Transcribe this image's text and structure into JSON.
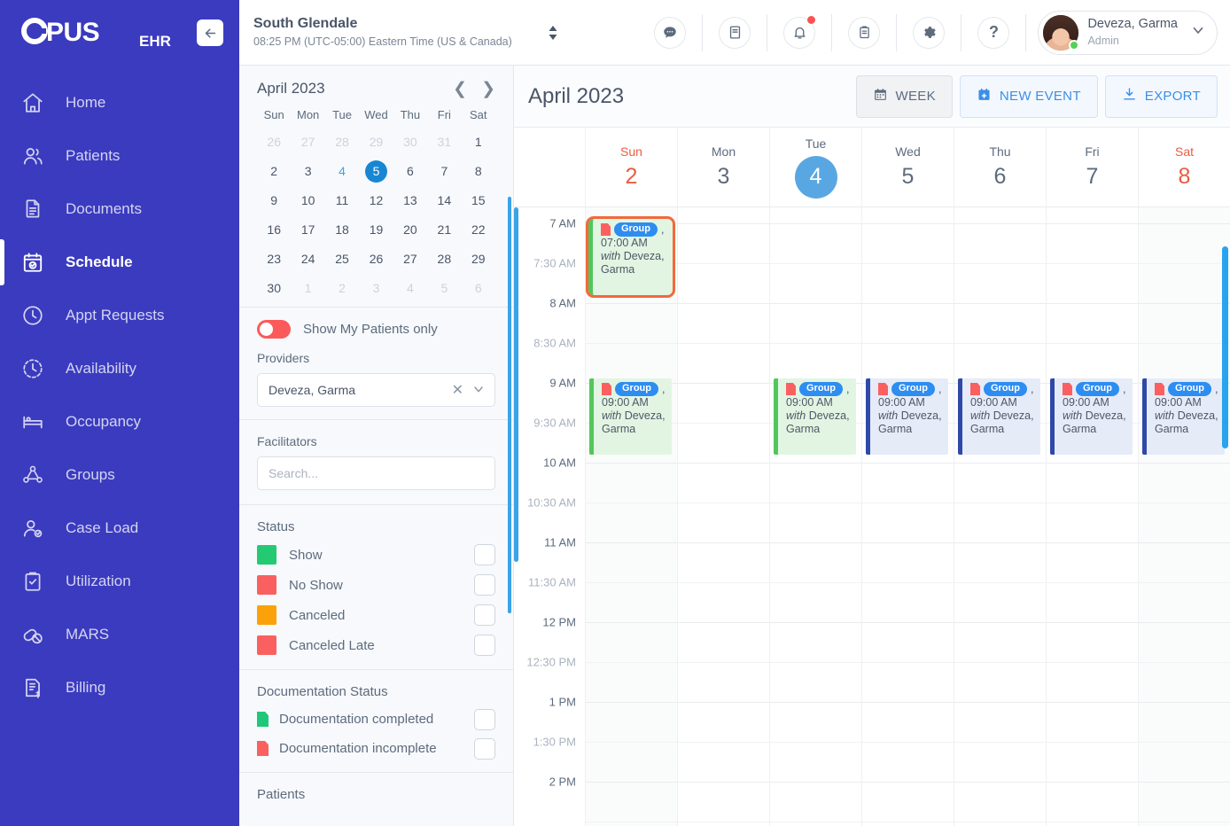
{
  "brand": {
    "logo": "OPUS",
    "suffix": "EHR",
    "collapse_icon": "arrow-left-icon"
  },
  "sidebar": {
    "items": [
      {
        "label": "Home",
        "icon": "home-icon",
        "active": false
      },
      {
        "label": "Patients",
        "icon": "users-icon",
        "active": false
      },
      {
        "label": "Documents",
        "icon": "documents-icon",
        "active": false
      },
      {
        "label": "Schedule",
        "icon": "calendar-check-icon",
        "active": true
      },
      {
        "label": "Appt Requests",
        "icon": "clock-icon",
        "active": false
      },
      {
        "label": "Availability",
        "icon": "clock-dashed-icon",
        "active": false
      },
      {
        "label": "Occupancy",
        "icon": "bed-icon",
        "active": false
      },
      {
        "label": "Groups",
        "icon": "group-network-icon",
        "active": false
      },
      {
        "label": "Case Load",
        "icon": "user-check-icon",
        "active": false
      },
      {
        "label": "Utilization",
        "icon": "clipboard-check-icon",
        "active": false
      },
      {
        "label": "MARS",
        "icon": "pills-icon",
        "active": false
      },
      {
        "label": "Billing",
        "icon": "invoice-dollar-icon",
        "active": false
      }
    ]
  },
  "topbar": {
    "location_name": "South Glendale",
    "location_time": "08:25 PM (UTC-05:00) Eastern Time (US & Canada)",
    "location_switch_icon": "sort-updown-icon",
    "icons": [
      {
        "name": "chat-icon",
        "glyph": "●●●",
        "badge": false
      },
      {
        "name": "book-icon",
        "glyph": "book",
        "badge": false
      },
      {
        "name": "bell-icon",
        "glyph": "bell",
        "badge": true
      },
      {
        "name": "clipboard-icon",
        "glyph": "clipboard",
        "badge": false
      },
      {
        "name": "gear-icon",
        "glyph": "gear",
        "badge": false
      },
      {
        "name": "help-icon",
        "glyph": "?",
        "badge": false
      }
    ],
    "user": {
      "name": "Deveza, Garma",
      "role": "Admin",
      "status": "online",
      "chevron": "chevron-down-icon"
    }
  },
  "filters": {
    "minicalendar": {
      "title": "April 2023",
      "prev_icon": "chevron-left-icon",
      "next_icon": "chevron-right-icon",
      "dow": [
        "Sun",
        "Mon",
        "Tue",
        "Wed",
        "Thu",
        "Fri",
        "Sat"
      ],
      "weeks": [
        [
          {
            "d": "26",
            "s": "muted"
          },
          {
            "d": "27",
            "s": "muted"
          },
          {
            "d": "28",
            "s": "muted"
          },
          {
            "d": "29",
            "s": "muted"
          },
          {
            "d": "30",
            "s": "muted"
          },
          {
            "d": "31",
            "s": "muted"
          },
          {
            "d": "1",
            "s": ""
          }
        ],
        [
          {
            "d": "2",
            "s": ""
          },
          {
            "d": "3",
            "s": ""
          },
          {
            "d": "4",
            "s": "accent"
          },
          {
            "d": "5",
            "s": "sel"
          },
          {
            "d": "6",
            "s": ""
          },
          {
            "d": "7",
            "s": ""
          },
          {
            "d": "8",
            "s": ""
          }
        ],
        [
          {
            "d": "9",
            "s": ""
          },
          {
            "d": "10",
            "s": ""
          },
          {
            "d": "11",
            "s": ""
          },
          {
            "d": "12",
            "s": ""
          },
          {
            "d": "13",
            "s": ""
          },
          {
            "d": "14",
            "s": ""
          },
          {
            "d": "15",
            "s": ""
          }
        ],
        [
          {
            "d": "16",
            "s": ""
          },
          {
            "d": "17",
            "s": ""
          },
          {
            "d": "18",
            "s": ""
          },
          {
            "d": "19",
            "s": ""
          },
          {
            "d": "20",
            "s": ""
          },
          {
            "d": "21",
            "s": ""
          },
          {
            "d": "22",
            "s": ""
          }
        ],
        [
          {
            "d": "23",
            "s": ""
          },
          {
            "d": "24",
            "s": ""
          },
          {
            "d": "25",
            "s": ""
          },
          {
            "d": "26",
            "s": ""
          },
          {
            "d": "27",
            "s": ""
          },
          {
            "d": "28",
            "s": ""
          },
          {
            "d": "29",
            "s": ""
          }
        ],
        [
          {
            "d": "30",
            "s": ""
          },
          {
            "d": "1",
            "s": "muted"
          },
          {
            "d": "2",
            "s": "muted"
          },
          {
            "d": "3",
            "s": "muted"
          },
          {
            "d": "4",
            "s": "muted"
          },
          {
            "d": "5",
            "s": "muted"
          },
          {
            "d": "6",
            "s": "muted"
          }
        ]
      ]
    },
    "my_patients_toggle": {
      "label": "Show My Patients only",
      "on": true
    },
    "providers": {
      "label": "Providers",
      "value": "Deveza, Garma",
      "clear_icon": "clear-x-icon",
      "chevron": "chevron-down-icon"
    },
    "facilitators": {
      "label": "Facilitators",
      "placeholder": "Search...",
      "value": ""
    },
    "status": {
      "label": "Status",
      "items": [
        {
          "label": "Show",
          "color": "#23ca72",
          "checked": false
        },
        {
          "label": "No Show",
          "color": "#fb6060",
          "checked": false
        },
        {
          "label": "Canceled",
          "color": "#fba20a",
          "checked": false
        },
        {
          "label": "Canceled Late",
          "color": "#fb6060",
          "checked": false
        }
      ]
    },
    "documentation_status": {
      "label": "Documentation Status",
      "items": [
        {
          "label": "Documentation completed",
          "color": "#1fc878",
          "checked": false
        },
        {
          "label": "Documentation incomplete",
          "color": "#fb6060",
          "checked": false
        }
      ]
    },
    "patients_section_label": "Patients"
  },
  "calendar": {
    "title": "April 2023",
    "buttons": [
      {
        "label": "WEEK",
        "icon": "calendar-icon",
        "style": "week"
      },
      {
        "label": "NEW EVENT",
        "icon": "calendar-plus-icon",
        "style": "blue"
      },
      {
        "label": "EXPORT",
        "icon": "download-icon",
        "style": "blue"
      }
    ],
    "days": [
      {
        "dow": "Sun",
        "num": "2",
        "weekend": true,
        "today": false
      },
      {
        "dow": "Mon",
        "num": "3",
        "weekend": false,
        "today": false
      },
      {
        "dow": "Tue",
        "num": "4",
        "weekend": false,
        "today": true
      },
      {
        "dow": "Wed",
        "num": "5",
        "weekend": false,
        "today": false
      },
      {
        "dow": "Thu",
        "num": "6",
        "weekend": false,
        "today": false
      },
      {
        "dow": "Fri",
        "num": "7",
        "weekend": false,
        "today": false
      },
      {
        "dow": "Sat",
        "num": "8",
        "weekend": true,
        "today": false
      }
    ],
    "time_labels": [
      {
        "t": "7 AM",
        "half": false
      },
      {
        "t": "7:30 AM",
        "half": true
      },
      {
        "t": "8 AM",
        "half": false
      },
      {
        "t": "8:30 AM",
        "half": true
      },
      {
        "t": "9 AM",
        "half": false
      },
      {
        "t": "9:30 AM",
        "half": true
      },
      {
        "t": "10 AM",
        "half": false
      },
      {
        "t": "10:30 AM",
        "half": true
      },
      {
        "t": "11 AM",
        "half": false
      },
      {
        "t": "11:30 AM",
        "half": true
      },
      {
        "t": "12 PM",
        "half": false
      },
      {
        "t": "12:30 PM",
        "half": true
      },
      {
        "t": "1 PM",
        "half": false
      },
      {
        "t": "1:30 PM",
        "half": true
      },
      {
        "t": "2 PM",
        "half": false
      }
    ],
    "events": [
      {
        "day": 0,
        "slot": 0,
        "badge": "Group",
        "sep": ",",
        "time": "07:00 AM",
        "with_prefix": "with",
        "with": "Deveza, Garma",
        "color": "green",
        "doc": "incomplete",
        "selected": true
      },
      {
        "day": 0,
        "slot": 4,
        "badge": "Group",
        "sep": ",",
        "time": "09:00 AM",
        "with_prefix": "with",
        "with": "Deveza, Garma",
        "color": "green",
        "doc": "incomplete",
        "selected": false
      },
      {
        "day": 2,
        "slot": 4,
        "badge": "Group",
        "sep": ",",
        "time": "09:00 AM",
        "with_prefix": "with",
        "with": "Deveza, Garma",
        "color": "green",
        "doc": "incomplete",
        "selected": false
      },
      {
        "day": 3,
        "slot": 4,
        "badge": "Group",
        "sep": ",",
        "time": "09:00 AM",
        "with_prefix": "with",
        "with": "Deveza, Garma",
        "color": "blue",
        "doc": "incomplete",
        "selected": false
      },
      {
        "day": 4,
        "slot": 4,
        "badge": "Group",
        "sep": ",",
        "time": "09:00 AM",
        "with_prefix": "with",
        "with": "Deveza, Garma",
        "color": "blue",
        "doc": "incomplete",
        "selected": false
      },
      {
        "day": 5,
        "slot": 4,
        "badge": "Group",
        "sep": ",",
        "time": "09:00 AM",
        "with_prefix": "with",
        "with": "Deveza, Garma",
        "color": "blue",
        "doc": "incomplete",
        "selected": false
      },
      {
        "day": 6,
        "slot": 4,
        "badge": "Group",
        "sep": ",",
        "time": "09:00 AM",
        "with_prefix": "with",
        "with": "Deveza, Garma",
        "color": "blue",
        "doc": "incomplete",
        "selected": false
      }
    ]
  },
  "colors": {
    "sidebar_bg": "#3b3bbf",
    "accent_blue": "#2e8df0",
    "today_blue": "#59a7e2",
    "selected_outline": "#f4683a",
    "event_green": "#53c65b",
    "event_blue": "#2f49a8",
    "toggle_on": "#fb5a5a",
    "weekend_text": "#ea5b42"
  }
}
